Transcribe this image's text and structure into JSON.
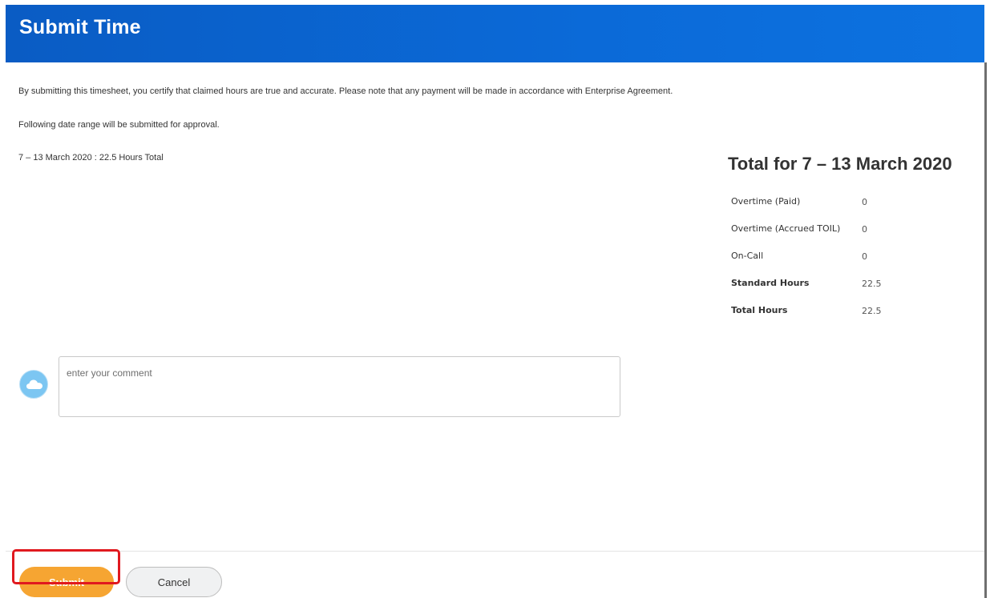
{
  "header": {
    "title": "Submit Time",
    "color": "#0b6ad8"
  },
  "main": {
    "certification_text": "By submitting this timesheet, you certify that claimed hours are true and accurate. Please note that any payment will be made in accordance with Enterprise Agreement.",
    "range_intro": "Following date range will be submitted for approval.",
    "range_line": "7 – 13 March 2020 : 22.5 Hours Total"
  },
  "totals": {
    "title": "Total for 7 – 13 March 2020",
    "rows": [
      {
        "label": "Overtime (Paid)",
        "value": "0"
      },
      {
        "label": "Overtime (Accrued TOIL)",
        "value": "0"
      },
      {
        "label": "On-Call",
        "value": "0"
      },
      {
        "label": "Standard Hours",
        "value": "22.5"
      },
      {
        "label": "Total Hours",
        "value": "22.5"
      }
    ]
  },
  "comment": {
    "avatar_icon": "cloud-icon",
    "placeholder": "enter your comment",
    "value": ""
  },
  "footer": {
    "submit_label": "Submit",
    "cancel_label": "Cancel",
    "submit_color": "#f6a532",
    "highlight_color": "#e0191f"
  }
}
